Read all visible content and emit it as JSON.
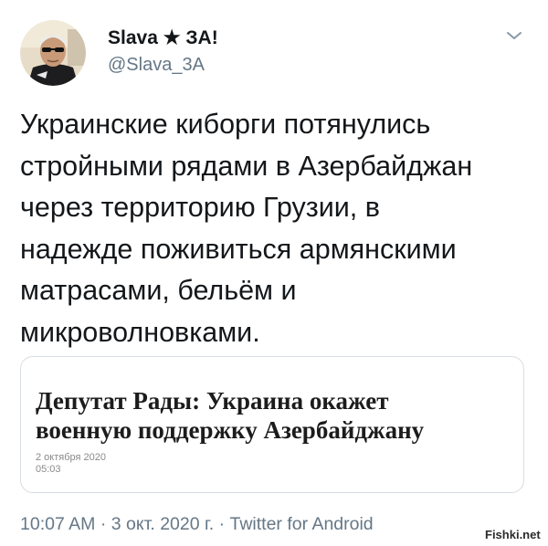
{
  "tweet": {
    "author": {
      "display_name": "Slava ★ ЗА!",
      "handle": "@Slava_3A",
      "avatar_icon": "user-avatar"
    },
    "menu_icon": "chevron-down-icon",
    "text_lines": [
      "Украинские киборги потянулись",
      "стройными рядами в Азербайджан",
      "через территорию Грузии, в",
      "надежде поживиться армянскими",
      "матрасами, бельём и",
      "микроволновками."
    ],
    "link_card": {
      "headline_lines": [
        "Депутат Рады: Украина окажет",
        "военную поддержку Азербайджану"
      ],
      "date": "2 октября 2020",
      "time": "05:03"
    },
    "footer": {
      "time": "10:07 AM",
      "date": "3 окт. 2020 г.",
      "source": "Twitter for Android",
      "separator": "·"
    }
  },
  "watermark": "Fishki.net",
  "colors": {
    "text": "#14171a",
    "secondary": "#657786",
    "card_border": "#d6dde3"
  }
}
